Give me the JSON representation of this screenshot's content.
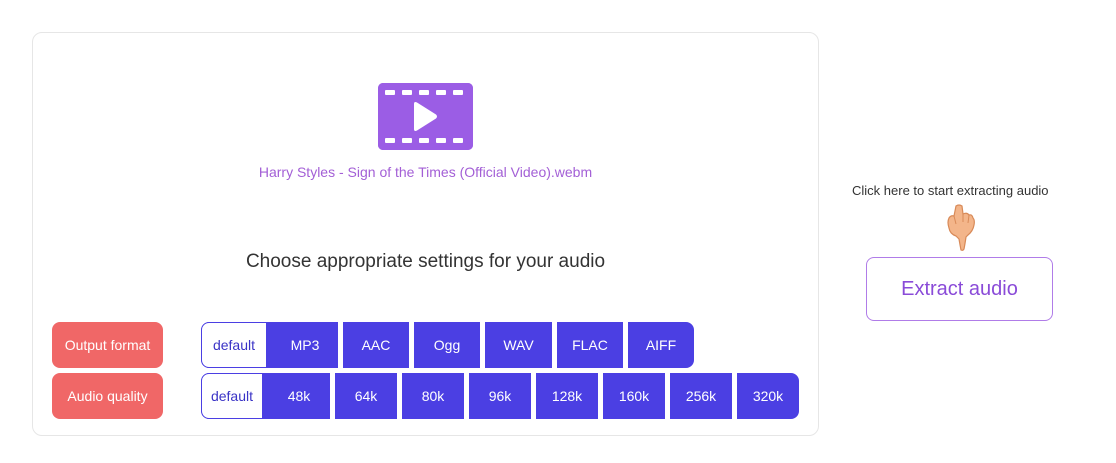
{
  "video": {
    "icon": "video-play-icon",
    "filename": "Harry Styles - Sign of the Times (Official Video).webm",
    "icon_color": "#9b5de5"
  },
  "settings": {
    "title": "Choose appropriate settings for your audio",
    "output_format": {
      "label": "Output format",
      "options": [
        "default",
        "MP3",
        "AAC",
        "Ogg",
        "WAV",
        "FLAC",
        "AIFF"
      ]
    },
    "audio_quality": {
      "label": "Audio quality",
      "options": [
        "default",
        "48k",
        "64k",
        "80k",
        "96k",
        "128k",
        "160k",
        "256k",
        "320k"
      ]
    },
    "colors": {
      "label_bg": "#f06767",
      "option_bg": "#4b3fe3"
    }
  },
  "extract": {
    "hint": "Click here to start extracting audio",
    "hint_icon": "pointing-hand-icon",
    "button_label": "Extract audio"
  }
}
